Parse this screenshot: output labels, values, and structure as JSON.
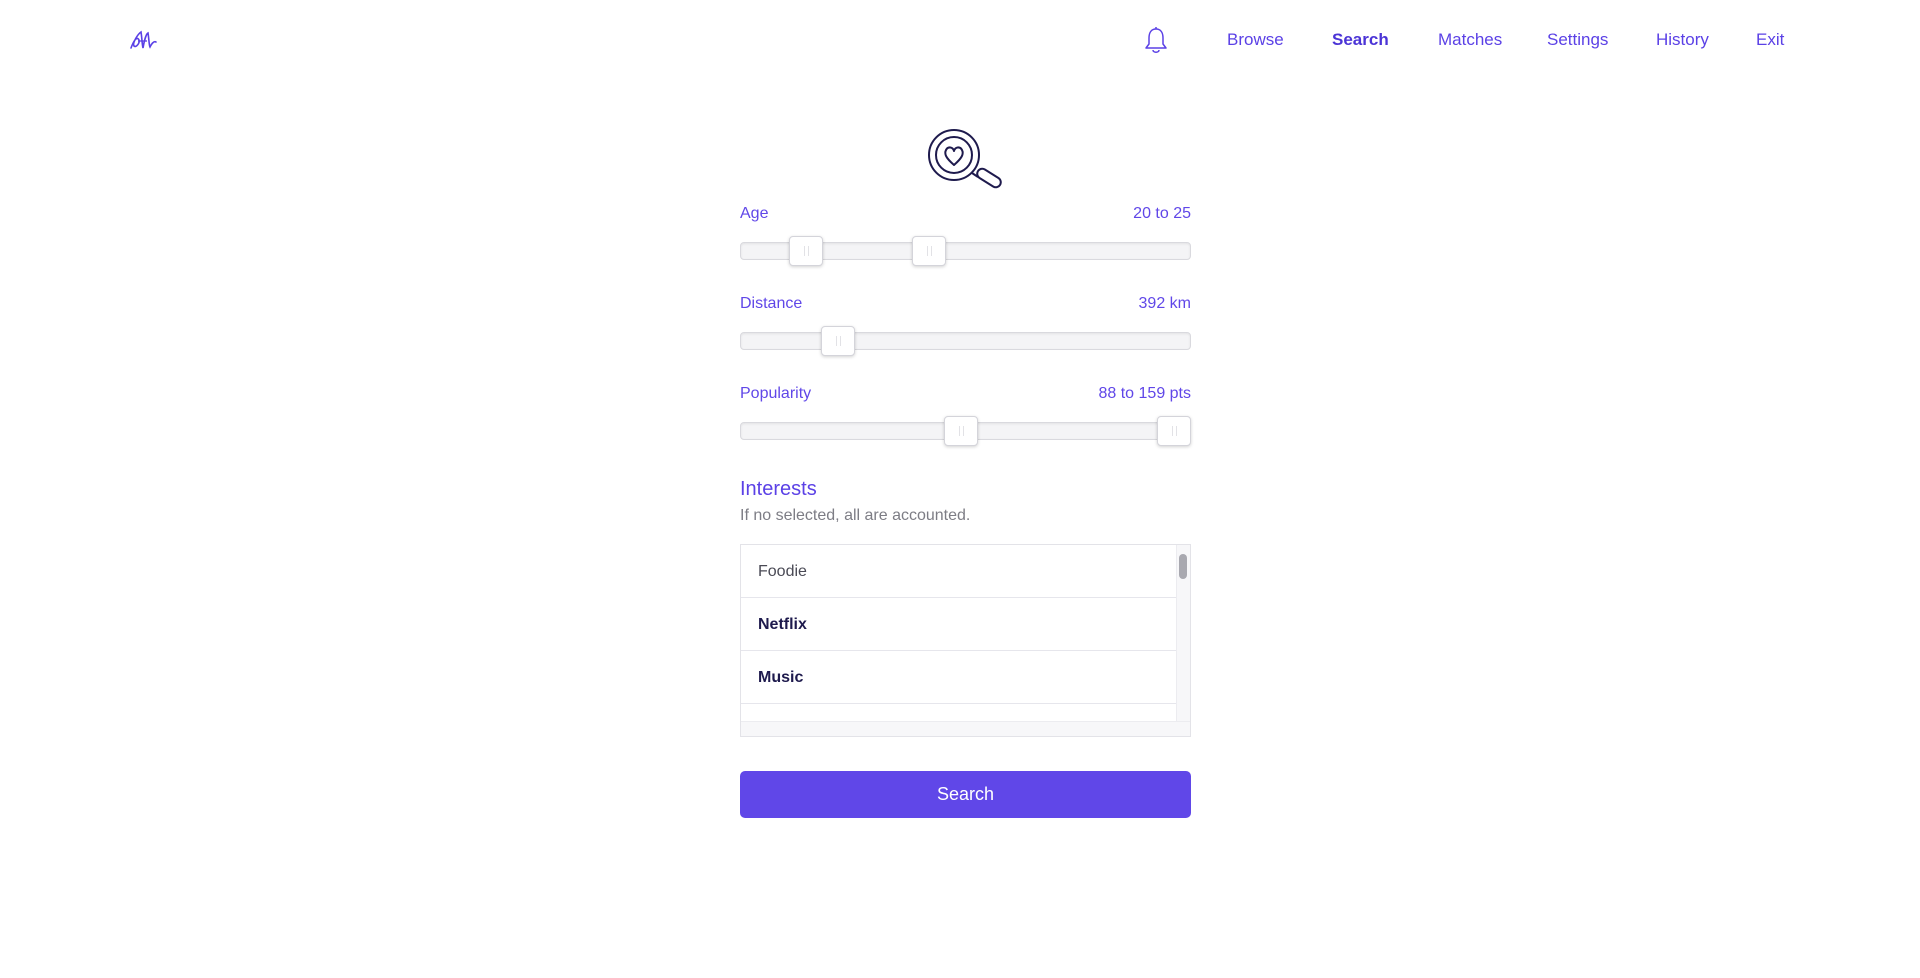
{
  "header": {
    "logo_icon": "heart-signature-logo-icon",
    "notifications_icon": "bell-icon",
    "nav": [
      {
        "label": "Browse",
        "active": false
      },
      {
        "label": "Search",
        "active": true
      },
      {
        "label": "Matches",
        "active": false
      },
      {
        "label": "Settings",
        "active": false
      },
      {
        "label": "History",
        "active": false
      },
      {
        "label": "Exit",
        "active": false
      }
    ]
  },
  "hero_icon": "magnifier-heart-icon",
  "filters": {
    "age": {
      "label": "Age",
      "value": "20 to 25",
      "min": 20,
      "max": 25
    },
    "distance": {
      "label": "Distance",
      "value": "392 km",
      "amount": 392
    },
    "popularity": {
      "label": "Popularity",
      "value": "88 to 159 pts",
      "min": 88,
      "max": 159
    }
  },
  "interests": {
    "title": "Interests",
    "hint": "If no selected, all are accounted.",
    "items": [
      {
        "label": "Foodie",
        "selected": false
      },
      {
        "label": "Netflix",
        "selected": true
      },
      {
        "label": "Music",
        "selected": true
      }
    ]
  },
  "search_button": "Search",
  "colors": {
    "accent": "#6047e8",
    "accent_dark": "#1e1a4d",
    "muted_text": "#7d7d85"
  }
}
